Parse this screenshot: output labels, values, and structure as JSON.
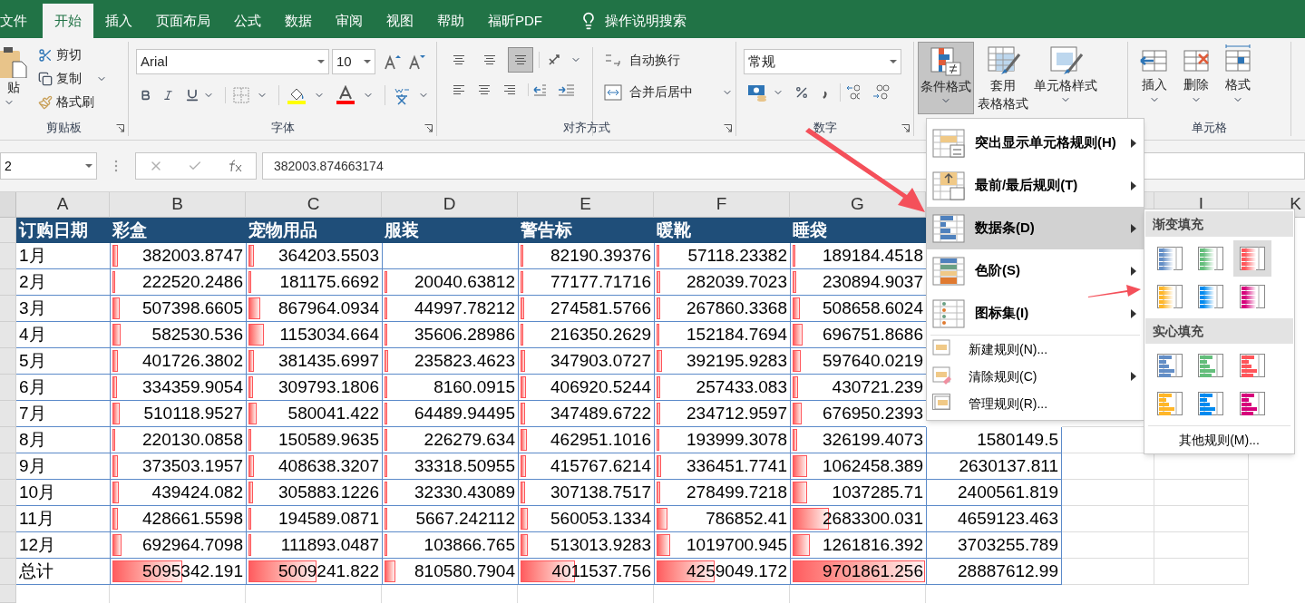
{
  "tabs": [
    {
      "label": "文件",
      "selected": false
    },
    {
      "label": "开始",
      "selected": true
    },
    {
      "label": "插入",
      "selected": false
    },
    {
      "label": "页面布局",
      "selected": false
    },
    {
      "label": "公式",
      "selected": false
    },
    {
      "label": "数据",
      "selected": false
    },
    {
      "label": "审阅",
      "selected": false
    },
    {
      "label": "视图",
      "selected": false
    },
    {
      "label": "帮助",
      "selected": false
    },
    {
      "label": "福昕PDF",
      "selected": false
    }
  ],
  "tell_me": "操作说明搜索",
  "ribbon": {
    "clipboard": {
      "paste": "贴",
      "cut": "剪切",
      "copy": "复制",
      "format_painter": "格式刷",
      "label": "剪贴板"
    },
    "font": {
      "family": "Arial",
      "size": "10",
      "label": "字体"
    },
    "alignment": {
      "vertical_align": [
        {
          "selected": false
        },
        {
          "selected": false
        },
        {
          "selected": true
        }
      ],
      "wrap": "自动换行",
      "merge": "合并后居中",
      "label": "对齐方式"
    },
    "number": {
      "format": "常规",
      "label": "数字"
    },
    "styles": [
      {
        "kind": "conditional",
        "lines": [
          "条件格式"
        ],
        "selected": true
      },
      {
        "kind": "table",
        "lines": [
          "套用",
          "表格格式"
        ],
        "selected": false
      },
      {
        "kind": "cell",
        "lines": [
          "单元格样式"
        ],
        "selected": false
      }
    ],
    "cells": {
      "buttons": [
        {
          "kind": "insert",
          "label": "插入"
        },
        {
          "kind": "delete",
          "label": "删除"
        },
        {
          "kind": "format",
          "label": "格式"
        }
      ],
      "label": "单元格"
    }
  },
  "formula_bar": {
    "name_box": "2",
    "formula": "382003.874663174"
  },
  "sheet": {
    "columns": [
      "A",
      "B",
      "C",
      "D",
      "E",
      "F",
      "G"
    ],
    "right_columns": [
      "I",
      "K"
    ],
    "header": [
      "订购日期",
      "彩盒",
      "宠物用品",
      "服装",
      "警告标",
      "暖靴",
      "睡袋"
    ],
    "rows": [
      {
        "cells": [
          {
            "value": "1月"
          },
          {
            "value": "382003.8747",
            "level": 0.039
          },
          {
            "value": "364203.5503",
            "level": 0.038
          },
          {},
          {
            "value": "82190.39376",
            "level": 0.008
          },
          {
            "value": "57118.23382",
            "level": 0.006
          },
          {
            "value": "189184.4518",
            "level": 0.019
          }
        ]
      },
      {
        "cells": [
          {
            "value": "2月"
          },
          {
            "value": "222520.2486",
            "level": 0.023
          },
          {
            "value": "181175.6692",
            "level": 0.019
          },
          {
            "value": "20040.63812",
            "level": 0.002
          },
          {
            "value": "77177.71716",
            "level": 0.008
          },
          {
            "value": "282039.7023",
            "level": 0.029
          },
          {
            "value": "230894.9037",
            "level": 0.024
          }
        ]
      },
      {
        "cells": [
          {
            "value": "3月"
          },
          {
            "value": "507398.6605",
            "level": 0.052
          },
          {
            "value": "867964.0934",
            "level": 0.089
          },
          {
            "value": "44997.78212",
            "level": 0.005
          },
          {
            "value": "274581.5766",
            "level": 0.028
          },
          {
            "value": "267860.3368",
            "level": 0.028
          },
          {
            "value": "508658.6024",
            "level": 0.052
          }
        ]
      },
      {
        "cells": [
          {
            "value": "4月"
          },
          {
            "value": "582530.536",
            "level": 0.06
          },
          {
            "value": "1153034.664",
            "level": 0.119
          },
          {
            "value": "35606.28986",
            "level": 0.004
          },
          {
            "value": "216350.2629",
            "level": 0.022
          },
          {
            "value": "152184.7694",
            "level": 0.016
          },
          {
            "value": "696751.8686",
            "level": 0.072
          }
        ]
      },
      {
        "cells": [
          {
            "value": "5月"
          },
          {
            "value": "401726.3802",
            "level": 0.041
          },
          {
            "value": "381435.6997",
            "level": 0.039
          },
          {
            "value": "235823.4623",
            "level": 0.024
          },
          {
            "value": "347903.0727",
            "level": 0.036
          },
          {
            "value": "392195.9283",
            "level": 0.04
          },
          {
            "value": "597640.0219",
            "level": 0.062
          }
        ]
      },
      {
        "cells": [
          {
            "value": "6月"
          },
          {
            "value": "334359.9054",
            "level": 0.034
          },
          {
            "value": "309793.1806",
            "level": 0.032
          },
          {
            "value": "8160.0915",
            "level": 0.001
          },
          {
            "value": "406920.5244",
            "level": 0.042
          },
          {
            "value": "257433.083",
            "level": 0.027
          },
          {
            "value": "430721.239",
            "level": 0.044
          }
        ]
      },
      {
        "cells": [
          {
            "value": "7月"
          },
          {
            "value": "510118.9527",
            "level": 0.053
          },
          {
            "value": "580041.422",
            "level": 0.06
          },
          {
            "value": "64489.94495",
            "level": 0.007
          },
          {
            "value": "347489.6722",
            "level": 0.036
          },
          {
            "value": "234712.9597",
            "level": 0.024
          },
          {
            "value": "676950.2393",
            "level": 0.07
          }
        ]
      },
      {
        "cells": [
          {
            "value": "8月"
          },
          {
            "value": "220130.0858",
            "level": 0.023
          },
          {
            "value": "150589.9635",
            "level": 0.016
          },
          {
            "value": "226279.634",
            "level": 0.023
          },
          {
            "value": "462951.1016",
            "level": 0.048
          },
          {
            "value": "193999.3078",
            "level": 0.02
          },
          {
            "value": "326199.4073",
            "level": 0.034
          },
          {
            "value": "1580149.5"
          }
        ]
      },
      {
        "cells": [
          {
            "value": "9月"
          },
          {
            "value": "373503.1957",
            "level": 0.038
          },
          {
            "value": "408638.3207",
            "level": 0.042
          },
          {
            "value": "33318.50955",
            "level": 0.003
          },
          {
            "value": "415767.6214",
            "level": 0.043
          },
          {
            "value": "336451.7741",
            "level": 0.035
          },
          {
            "value": "1062458.389",
            "level": 0.11
          },
          {
            "value": "2630137.811"
          }
        ]
      },
      {
        "cells": [
          {
            "value": "10月"
          },
          {
            "value": "439424.082",
            "level": 0.045
          },
          {
            "value": "305883.1226",
            "level": 0.032
          },
          {
            "value": "32330.43089",
            "level": 0.003
          },
          {
            "value": "307138.7517",
            "level": 0.032
          },
          {
            "value": "278499.7218",
            "level": 0.029
          },
          {
            "value": "1037285.71",
            "level": 0.107
          },
          {
            "value": "2400561.819"
          }
        ]
      },
      {
        "cells": [
          {
            "value": "11月"
          },
          {
            "value": "428661.5598",
            "level": 0.044
          },
          {
            "value": "194589.0871",
            "level": 0.02
          },
          {
            "value": "5667.242112",
            "level": 0.001
          },
          {
            "value": "560053.1334",
            "level": 0.058
          },
          {
            "value": "786852.41",
            "level": 0.081
          },
          {
            "value": "2683300.031",
            "level": 0.277
          },
          {
            "value": "4659123.463"
          }
        ]
      },
      {
        "cells": [
          {
            "value": "12月"
          },
          {
            "value": "692964.7098",
            "level": 0.071
          },
          {
            "value": "111893.0487",
            "level": 0.012
          },
          {
            "value": "103866.765",
            "level": 0.011
          },
          {
            "value": "513013.9283",
            "level": 0.053
          },
          {
            "value": "1019700.945",
            "level": 0.105
          },
          {
            "value": "1261816.392",
            "level": 0.13
          },
          {
            "value": "3703255.789"
          }
        ]
      },
      {
        "cells": [
          {
            "value": "总计"
          },
          {
            "value": "5095342.191",
            "level": 0.525
          },
          {
            "value": "5009241.822",
            "level": 0.516
          },
          {
            "value": "810580.7904",
            "level": 0.084
          },
          {
            "value": "4011537.756",
            "level": 0.413
          },
          {
            "value": "4259049.172",
            "level": 0.439
          },
          {
            "value": "9701861.256",
            "level": 1
          },
          {
            "value": "28887612.99"
          }
        ]
      }
    ]
  },
  "menu": {
    "items": [
      {
        "kind": "highlight",
        "label": "突出显示单元格规则(H)",
        "submenu": true,
        "selected": false
      },
      {
        "kind": "top-bottom",
        "label": "最前/最后规则(T)",
        "submenu": true,
        "selected": false
      },
      {
        "kind": "data-bars",
        "label": "数据条(D)",
        "submenu": true,
        "selected": true
      },
      {
        "kind": "color-scale",
        "label": "色阶(S)",
        "submenu": true,
        "selected": false
      },
      {
        "kind": "icon-set",
        "label": "图标集(I)",
        "submenu": true,
        "selected": false
      },
      {
        "kind": "new-rule",
        "label": "新建规则(N)...",
        "submenu": false,
        "selected": false
      },
      {
        "kind": "clear-rules",
        "label": "清除规则(C)",
        "submenu": true,
        "selected": false
      },
      {
        "kind": "manage-rules",
        "label": "管理规则(R)...",
        "submenu": false,
        "selected": false
      }
    ]
  },
  "submenu": {
    "sections": [
      {
        "title": "渐变填充",
        "kind": "gradient",
        "swatches": [
          {
            "color": "#638ec6",
            "selected": false
          },
          {
            "color": "#63be7b",
            "selected": false
          },
          {
            "color": "#ff555a",
            "selected": true
          },
          {
            "color": "#ffb628",
            "selected": false
          },
          {
            "color": "#008aef",
            "selected": false
          },
          {
            "color": "#d6007b",
            "selected": false
          }
        ]
      },
      {
        "title": "实心填充",
        "kind": "solid",
        "swatches": [
          {
            "color": "#638ec6",
            "selected": false
          },
          {
            "color": "#63be7b",
            "selected": false
          },
          {
            "color": "#ff555a",
            "selected": false
          },
          {
            "color": "#ffb628",
            "selected": false
          },
          {
            "color": "#008aef",
            "selected": false
          },
          {
            "color": "#d6007b",
            "selected": false
          }
        ]
      }
    ],
    "more": "其他规则(M)..."
  }
}
